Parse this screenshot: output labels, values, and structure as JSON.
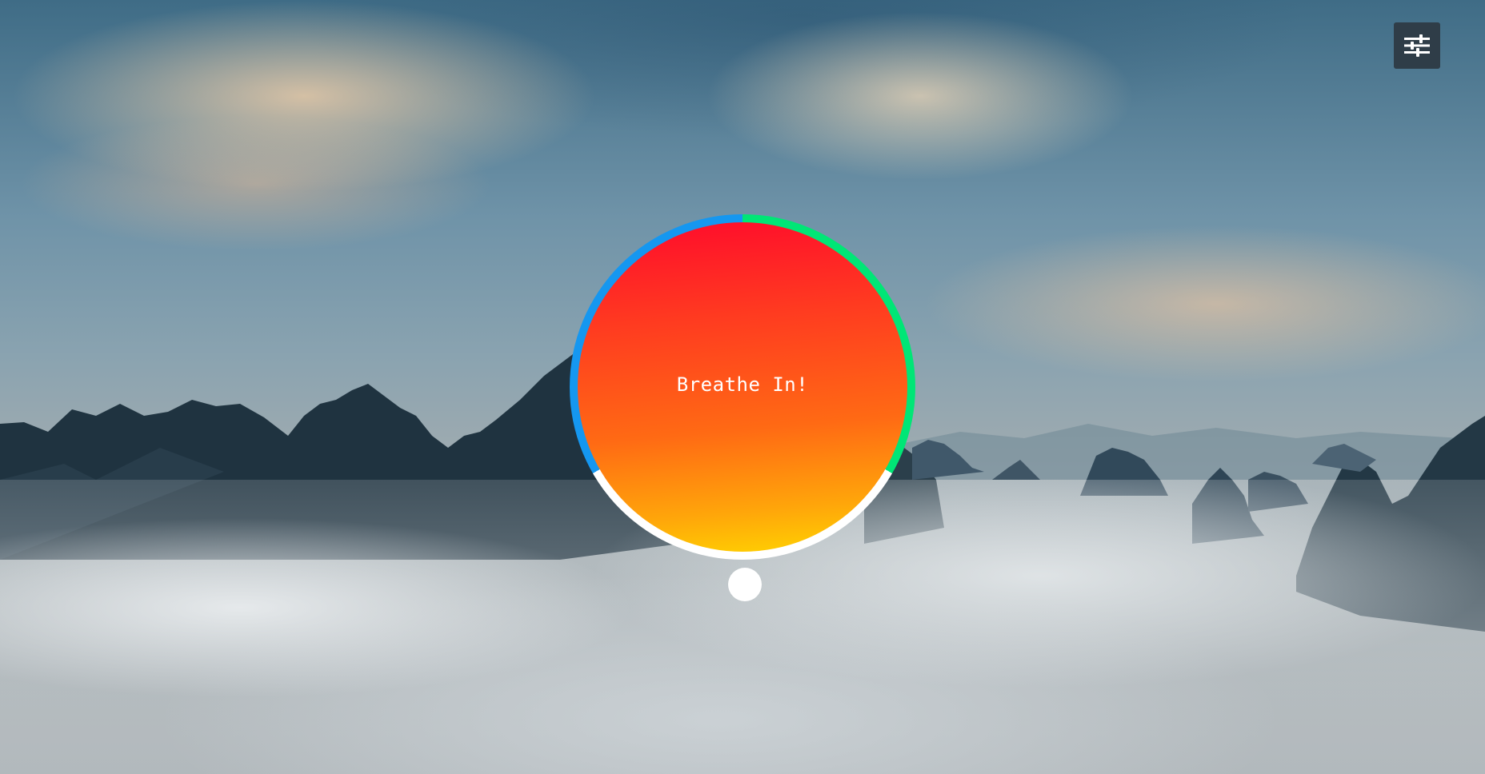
{
  "toolbar": {
    "settings_icon": "sliders-icon"
  },
  "breath": {
    "prompt": "Breathe In!",
    "phases": [
      {
        "name": "breathe-in",
        "color": "#00e676"
      },
      {
        "name": "hold",
        "color": "#ffffff"
      },
      {
        "name": "breathe-out",
        "color": "#1597f0"
      }
    ],
    "core_gradient": [
      "#ff0a2c",
      "#ff6a14",
      "#ffd600"
    ]
  },
  "background": {
    "sky_color": "#3f6c86",
    "fog_color": "#c4c9cb"
  }
}
